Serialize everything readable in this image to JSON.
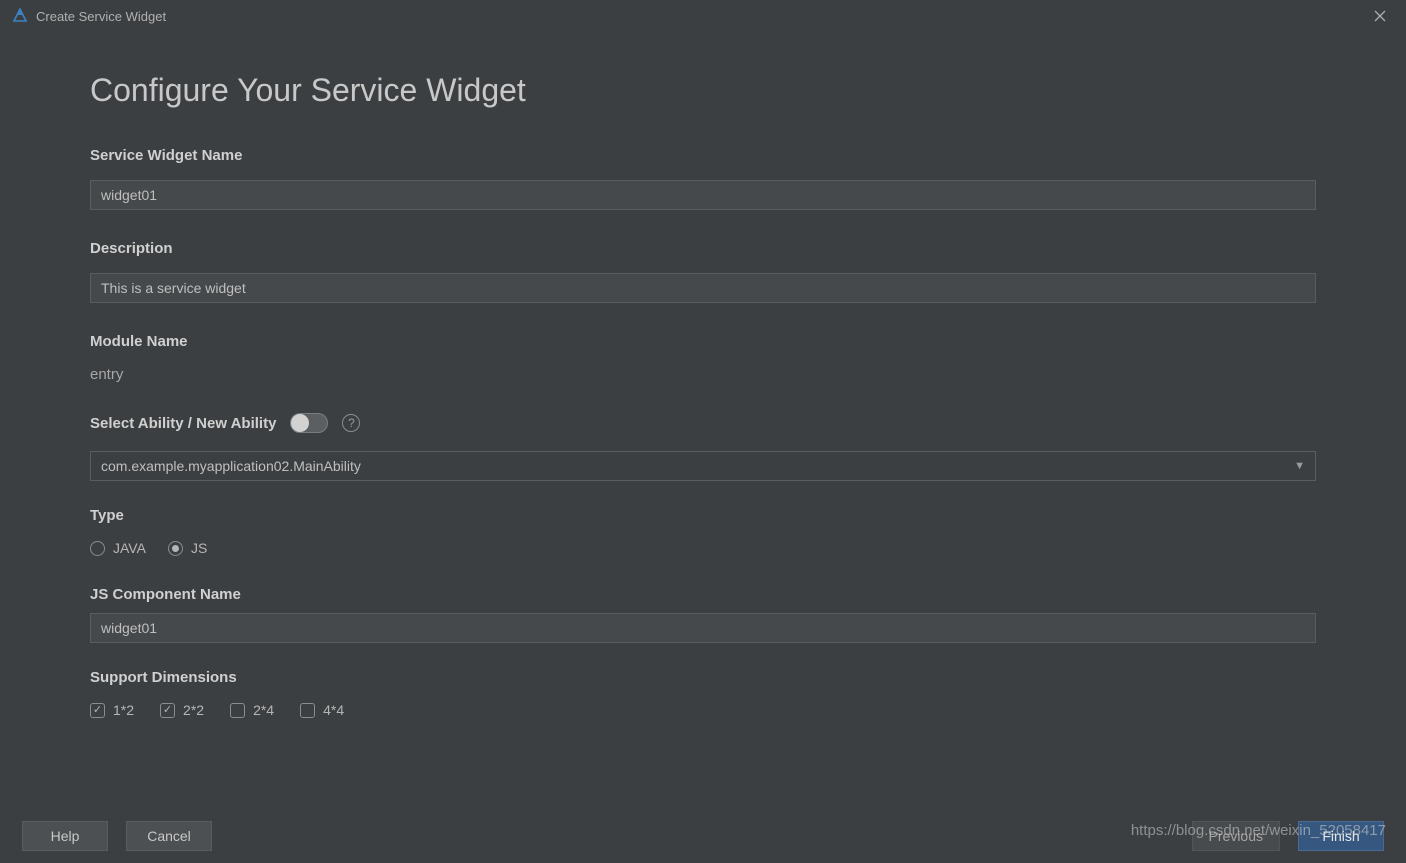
{
  "window": {
    "title": "Create Service Widget"
  },
  "page": {
    "heading": "Configure Your Service Widget"
  },
  "form": {
    "name": {
      "label": "Service Widget Name",
      "value": "widget01"
    },
    "description": {
      "label": "Description",
      "value": "This is a service widget"
    },
    "module": {
      "label": "Module Name",
      "value": "entry"
    },
    "ability": {
      "label": "Select Ability / New Ability",
      "toggle": false,
      "selected": "com.example.myapplication02.MainAbility"
    },
    "type": {
      "label": "Type",
      "options": [
        {
          "label": "JAVA",
          "selected": false
        },
        {
          "label": "JS",
          "selected": true
        }
      ]
    },
    "jsComponent": {
      "label": "JS Component Name",
      "value": "widget01"
    },
    "dimensions": {
      "label": "Support Dimensions",
      "options": [
        {
          "label": "1*2",
          "checked": true
        },
        {
          "label": "2*2",
          "checked": true
        },
        {
          "label": "2*4",
          "checked": false
        },
        {
          "label": "4*4",
          "checked": false
        }
      ]
    }
  },
  "footer": {
    "help": "Help",
    "cancel": "Cancel",
    "previous": "Previous",
    "finish": "Finish"
  },
  "watermark": "https://blog.csdn.net/weixin_52058417"
}
